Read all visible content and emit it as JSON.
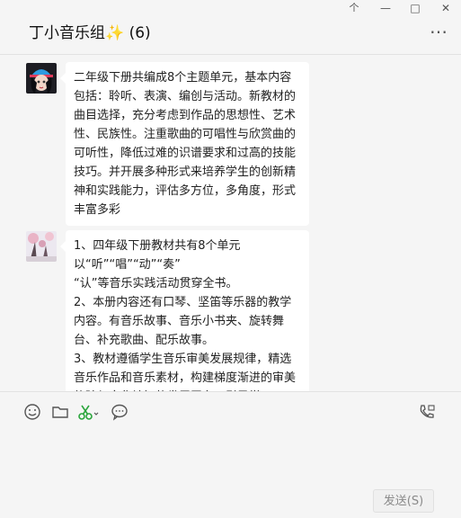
{
  "window": {
    "pin_glyph": "个",
    "minimize_glyph": "—",
    "maximize_glyph": "□",
    "close_glyph": "✕"
  },
  "header": {
    "title": "丁小音乐组✨ (6)",
    "more_glyph": "…"
  },
  "messages": [
    {
      "text": "二年级下册共编成8个主题单元，基本内容包括：聆听、表演、编创与活动。新教材的曲目选择，充分考虑到作品的思想性、艺术性、民族性。注重歌曲的可唱性与欣赏曲的可听性，降低过难的识谱要求和过高的技能技巧。并开展多种形式来培养学生的创新精神和实践能力，评估多方位，多角度，形式丰富多彩"
    },
    {
      "text": "1、四年级下册教材共有8个单元以“听”“唱”“动”“奏”\n“认”等音乐实践活动贯穿全书。\n2、本册内容还有口琴、坚笛等乐器的教学内容。有音乐故事、音乐小书夹、旋转舞台、补充歌曲、配乐故事。\n3、教材遵循学生音乐审美发展规律，精选音乐作品和音乐素材，构建梯度渐进的审美体验与文化认知的发展平台，引导学"
    }
  ],
  "send_button": "发送(S)",
  "colors": {
    "background": "#f5f5f5",
    "bubble": "#ffffff",
    "scissors": "#2aa53c"
  }
}
